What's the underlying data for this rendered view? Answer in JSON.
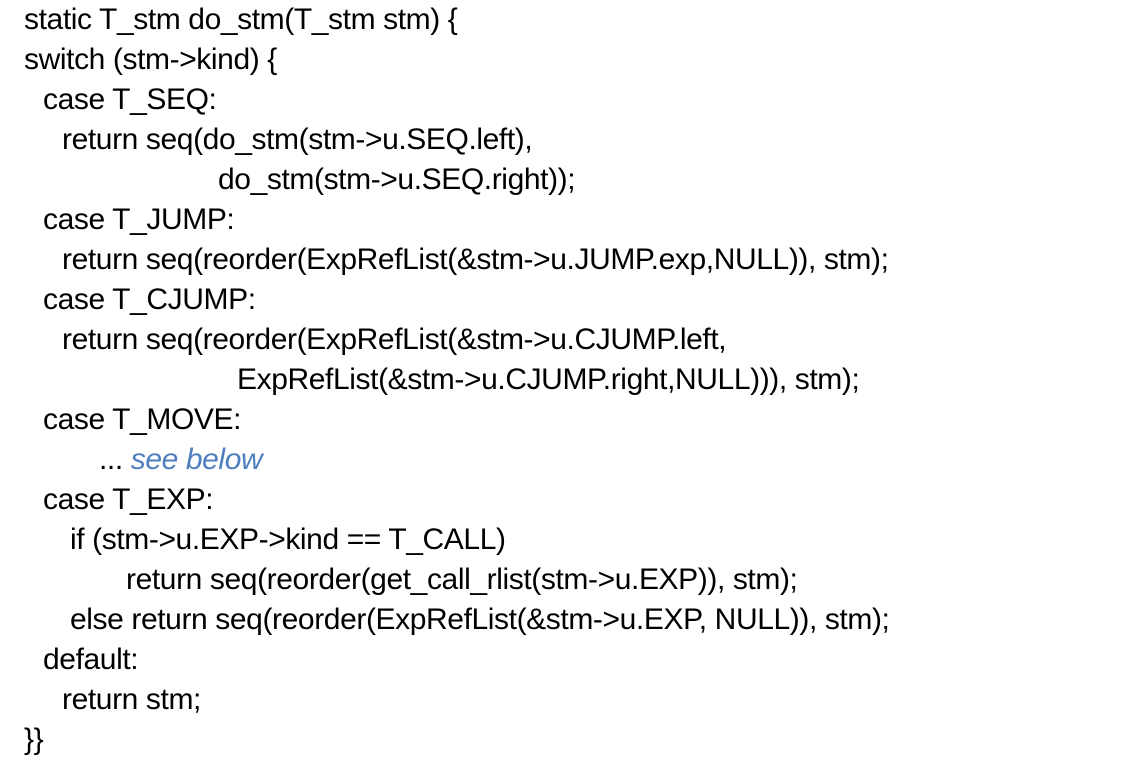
{
  "code": {
    "line_01": "static T_stm do_stm(T_stm stm) {",
    "line_02": "switch (stm->kind) {",
    "line_03": "case T_SEQ:",
    "line_04": "return seq(do_stm(stm->u.SEQ.left),",
    "line_05": "do_stm(stm->u.SEQ.right));",
    "line_06": "case T_JUMP:",
    "line_07": "return seq(reorder(ExpRefList(&stm->u.JUMP.exp,NULL)), stm);",
    "line_08": "case T_CJUMP:",
    "line_09": "return seq(reorder(ExpRefList(&stm->u.CJUMP.left,",
    "line_10": "ExpRefList(&stm->u.CJUMP.right,NULL))), stm);",
    "line_11": "case T_MOVE:",
    "line_12_ellipsis": "...",
    "line_12_note": "see below",
    "line_13": "case T_EXP:",
    "line_14": "if (stm->u.EXP->kind == T_CALL)",
    "line_15": "return seq(reorder(get_call_rlist(stm->u.EXP)), stm);",
    "line_16": "else return seq(reorder(ExpRefList(&stm->u.EXP, NULL)), stm);",
    "line_17": "default:",
    "line_18": "return stm;",
    "line_19": "}}"
  },
  "colors": {
    "text": "#000000",
    "note": "#4f7fbf",
    "background": "#ffffff"
  }
}
